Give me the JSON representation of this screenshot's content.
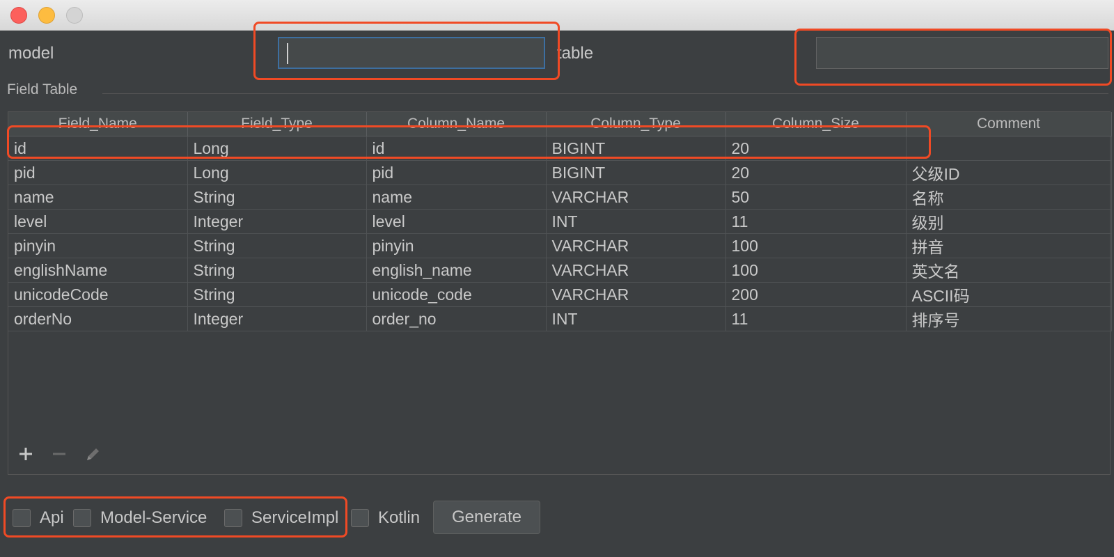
{
  "form": {
    "model_label": "model",
    "model_value": "",
    "table_label": "table",
    "table_value": ""
  },
  "field_table": {
    "title": "Field Table",
    "columns": [
      "Field_Name",
      "Field_Type",
      "Column_Name",
      "Column_Type",
      "Column_Size",
      "Comment"
    ],
    "rows": [
      [
        "id",
        "Long",
        "id",
        "BIGINT",
        "20",
        ""
      ],
      [
        "pid",
        "Long",
        "pid",
        "BIGINT",
        "20",
        "父级ID"
      ],
      [
        "name",
        "String",
        "name",
        "VARCHAR",
        "50",
        "名称"
      ],
      [
        "level",
        "Integer",
        "level",
        "INT",
        "11",
        "级别"
      ],
      [
        "pinyin",
        "String",
        "pinyin",
        "VARCHAR",
        "100",
        "拼音"
      ],
      [
        "englishName",
        "String",
        "english_name",
        "VARCHAR",
        "100",
        "英文名"
      ],
      [
        "unicodeCode",
        "String",
        "unicode_code",
        "VARCHAR",
        "200",
        "ASCII码"
      ],
      [
        "orderNo",
        "Integer",
        "order_no",
        "INT",
        "11",
        "排序号"
      ]
    ],
    "toolbar": {
      "add_icon": "plus-icon",
      "remove_icon": "minus-icon",
      "edit_icon": "pencil-icon"
    }
  },
  "options": {
    "api_label": "Api",
    "model_service_label": "Model-Service",
    "service_impl_label": "ServiceImpl",
    "kotlin_label": "Kotlin",
    "api_checked": false,
    "model_service_checked": false,
    "service_impl_checked": false,
    "kotlin_checked": false
  },
  "generate_label": "Generate",
  "colors": {
    "background": "#3c3f41",
    "annotation": "#f04a25",
    "focus_border": "#3d6fa1"
  }
}
